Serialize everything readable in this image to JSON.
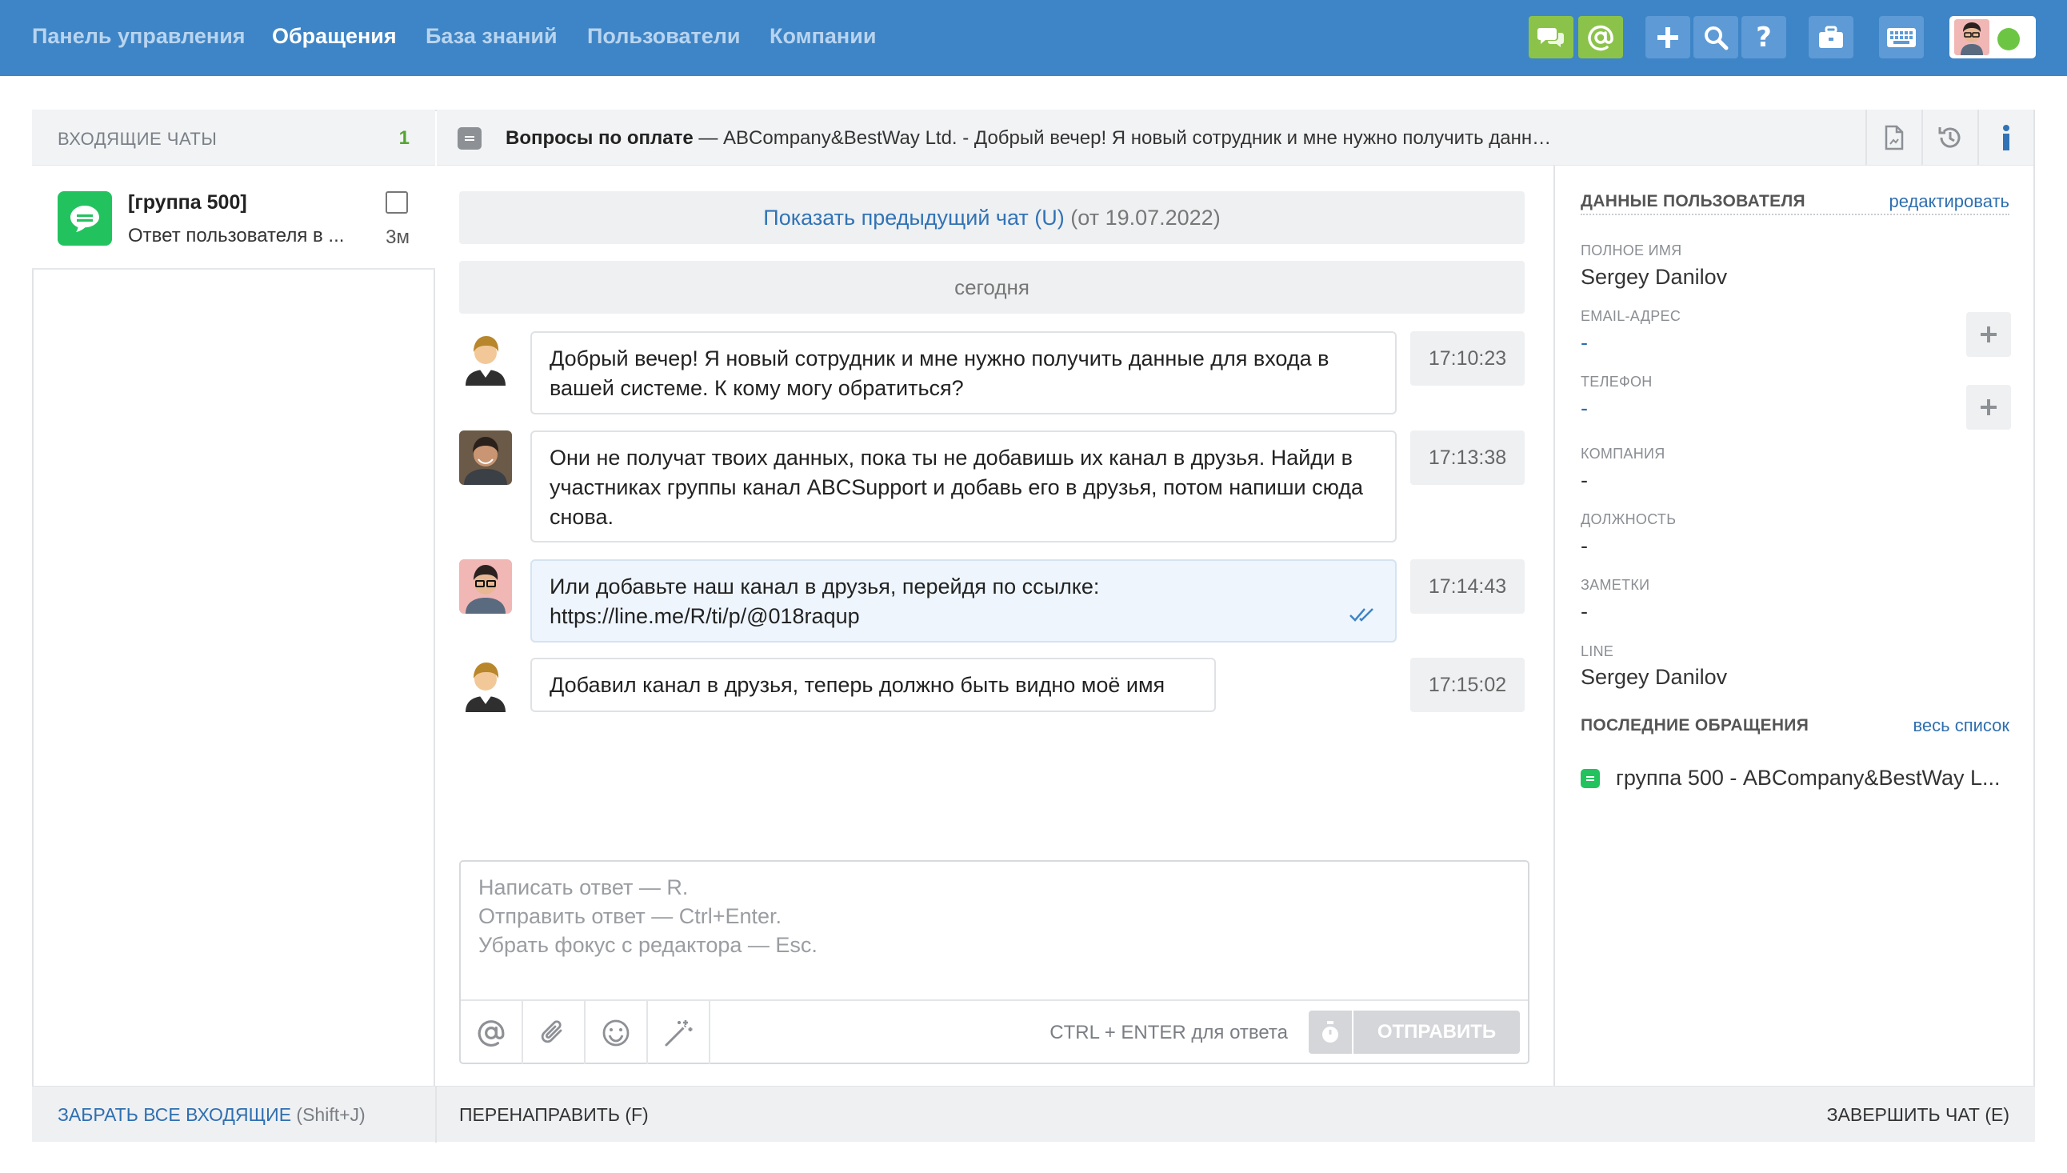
{
  "nav": {
    "items": [
      {
        "label": "Панель управления"
      },
      {
        "label": "Обращения"
      },
      {
        "label": "База знаний"
      },
      {
        "label": "Пользователи"
      },
      {
        "label": "Компании"
      }
    ]
  },
  "toolbar": {
    "icons": [
      "chats-icon",
      "mention-icon",
      "plus-icon",
      "search-icon",
      "help-icon",
      "briefcase-icon",
      "keyboard-icon"
    ],
    "status": "online",
    "status_color": "#6cc644"
  },
  "inbox": {
    "title": "ВХОДЯЩИЕ ЧАТЫ",
    "count": "1",
    "chats": [
      {
        "title": "[группа 500]",
        "preview": "Ответ пользователя в ...",
        "time": "3м"
      }
    ]
  },
  "chat": {
    "subject": "Вопросы по оплате",
    "header_rest": " — ABCompany&BestWay Ltd. - Добрый вечер! Я новый сотрудник и мне нужно получить данн…",
    "prev_link": "Показать предыдущий чат (U)",
    "prev_date": " (от 19.07.2022)",
    "day_label": "сегодня",
    "messages": [
      {
        "text": "Добрый вечер! Я новый сотрудник и мне нужно получить данные для входа в вашей системе. К кому могу обратиться?",
        "time": "17:10:23"
      },
      {
        "text": "Они не получат твоих данных, пока ты не добавишь их канал в друзья. Найди в участниках группы канал ABCSupport и добавь его в друзья, потом напиши сюда снова.",
        "time": "17:13:38"
      },
      {
        "text": "Или добавьте наш канал в друзья, перейдя по ссылке: https://line.me/R/ti/p/@018raqup",
        "time": "17:14:43"
      },
      {
        "text": "Добавил канал в друзья, теперь должно быть видно моё имя",
        "time": "17:15:02"
      }
    ]
  },
  "editor": {
    "placeholder_lines": [
      "Написать ответ — R.",
      "Отправить ответ — Ctrl+Enter.",
      "Убрать фокус с редактора — Esc."
    ],
    "hint": "CTRL + ENTER для ответа",
    "send_label": "ОТПРАВИТЬ"
  },
  "user_panel": {
    "section_title": "ДАННЫЕ ПОЛЬЗОВАТЕЛЯ",
    "edit_link": "редактировать",
    "fields": [
      {
        "label": "ПОЛНОЕ ИМЯ",
        "value": "Sergey Danilov"
      },
      {
        "label": "EMAIL-АДРЕС",
        "value": "-"
      },
      {
        "label": "ТЕЛЕФОН",
        "value": "-"
      },
      {
        "label": "КОМПАНИЯ",
        "value": "-"
      },
      {
        "label": "ДОЛЖНОСТЬ",
        "value": "-"
      },
      {
        "label": "ЗАМЕТКИ",
        "value": "-"
      },
      {
        "label": "LINE",
        "value": "Sergey Danilov"
      }
    ],
    "recent_title": "ПОСЛЕДНИЕ ОБРАЩЕНИЯ",
    "recent_link": "весь список",
    "recent_items": [
      "группа 500 - ABCompany&BestWay L..."
    ]
  },
  "footer": {
    "take_all": "ЗАБРАТЬ ВСЕ ВХОДЯЩИЕ",
    "take_all_hint": " (Shift+J)",
    "redirect": "ПЕРЕНАПРАВИТЬ (F)",
    "finish": "ЗАВЕРШИТЬ ЧАТ (E)"
  }
}
